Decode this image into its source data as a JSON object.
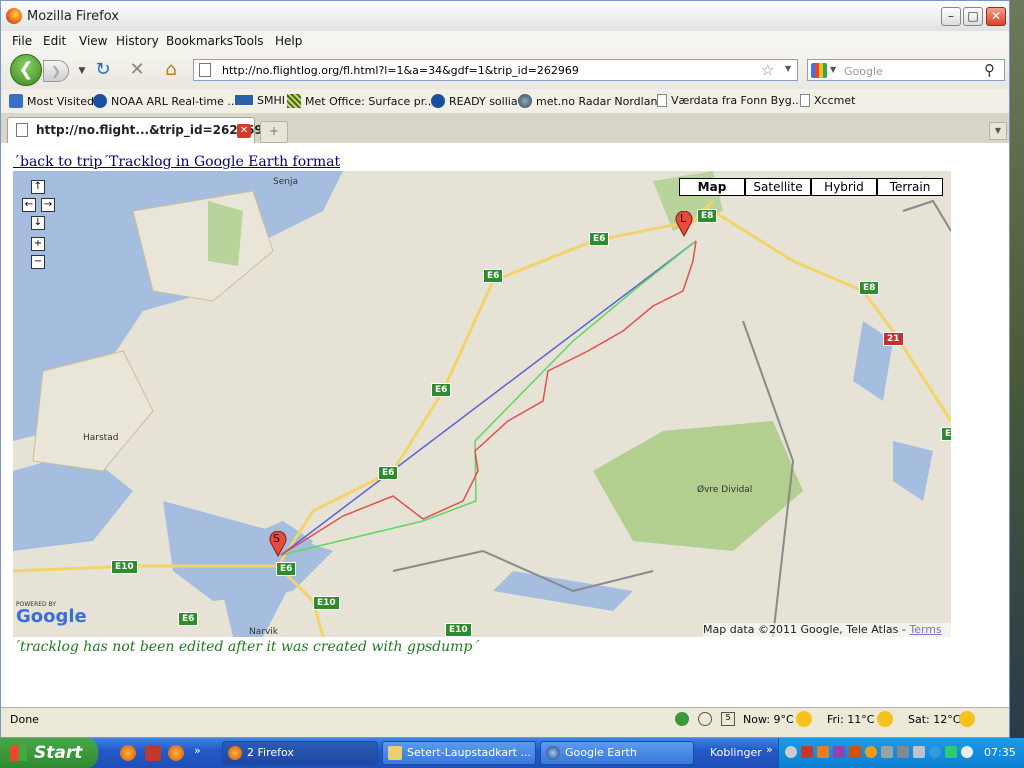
{
  "window": {
    "title": "Mozilla Firefox"
  },
  "menu": [
    "File",
    "Edit",
    "View",
    "History",
    "Bookmarks",
    "Tools",
    "Help"
  ],
  "nav": {
    "url": "http://no.flightlog.org/fl.html?l=1&a=34&gdf=1&trip_id=262969",
    "search_placeholder": "Google"
  },
  "bookmarks": [
    "Most Visited",
    "NOAA ARL Real-time ...",
    "SMHI",
    "Met Office: Surface pr...",
    "READY sollia",
    "met.no Radar Nordland",
    "Værdata fra Fonn Byg...",
    "Xccmet"
  ],
  "tab": {
    "title": "http://no.flight...&trip_id=262969"
  },
  "page": {
    "back_link": "´back to trip´",
    "ge_link": "Tracklog in Google Earth format",
    "note": "´tracklog has not been edited after it was created with gpsdump´"
  },
  "map": {
    "types": [
      "Map",
      "Satellite",
      "Hybrid",
      "Terrain"
    ],
    "selected_type": "Map",
    "attribution": "Map data ©2011 Google, Tele Atlas - ",
    "terms": "Terms of Use",
    "logo_powered": "POWERED BY",
    "logo": "Google",
    "marker_start": "S",
    "marker_end": "L",
    "places": [
      "Senja",
      "Harstad",
      "Øvre Dividal",
      "Narvik"
    ],
    "roads": [
      "E8",
      "E6",
      "E6",
      "E6",
      "E6",
      "E8",
      "21",
      "E6",
      "E10",
      "E10",
      "E6",
      "E10",
      "E"
    ]
  },
  "status": {
    "text": "Done",
    "weather_now": "Now: 9°C",
    "weather_fri": "Fri: 11°C",
    "weather_sat": "Sat: 12°C"
  },
  "taskbar": {
    "start": "Start",
    "tasks": [
      "2 Firefox",
      "Setert-Laupstadkart ...",
      "Google Earth"
    ],
    "toolbar_label": "Koblinger",
    "clock": "07:35"
  },
  "colors": {
    "track": "#e05050",
    "route_green": "#5fd85f",
    "route_blue": "#5a62d8",
    "link": "#00007f",
    "note": "#1e7a1e"
  }
}
